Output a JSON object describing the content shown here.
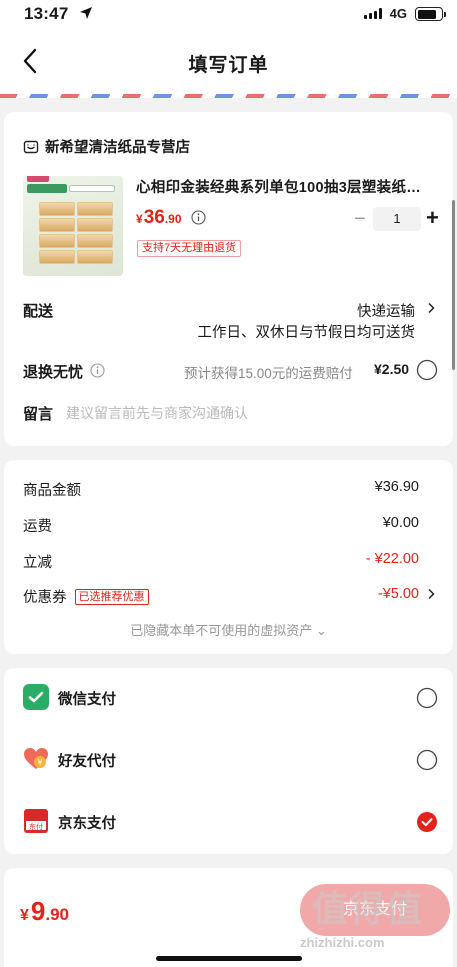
{
  "status_bar": {
    "time": "13:47",
    "network": "4G"
  },
  "nav": {
    "title": "填写订单"
  },
  "shop": {
    "name": "新希望清洁纸品专营店",
    "product_title": "心相印金装经典系列单包100抽3层塑装纸…",
    "price_symbol": "¥",
    "price_int": "36",
    "price_dec": ".90",
    "quantity": "1",
    "minus": "−",
    "plus": "+",
    "return_tag": "支持7天无理由退货"
  },
  "shipping": {
    "label": "配送",
    "method": "快递运输",
    "note": "工作日、双休日与节假日均可送货"
  },
  "worry_free": {
    "label": "退换无忧",
    "desc": "预计获得15.00元的运费赔付",
    "price": "¥2.50"
  },
  "message": {
    "label": "留言",
    "placeholder": "建议留言前先与商家沟通确认"
  },
  "summary": {
    "goods_label": "商品金额",
    "goods_value": "¥36.90",
    "freight_label": "运费",
    "freight_value": "¥0.00",
    "discount_label": "立减",
    "discount_value": "- ¥22.00",
    "coupon_label": "优惠券",
    "coupon_tag": "已选推荐优惠",
    "coupon_value": "-¥5.00",
    "hidden_note": "已隐藏本单不可使用的虚拟资产 ⌄"
  },
  "payment": {
    "wechat": "微信支付",
    "friend": "好友代付",
    "jd": "京东支付",
    "selected": "jd"
  },
  "footer": {
    "total_symbol": "¥",
    "total_int": "9",
    "total_dec": ".90",
    "submit_label": "京东支付"
  },
  "watermark": {
    "main": "值得值",
    "sub": "zhizhizhi.com"
  },
  "colors": {
    "accent": "#e2231a",
    "wechat": "#2aae67",
    "jd_red": "#d82a2a"
  }
}
